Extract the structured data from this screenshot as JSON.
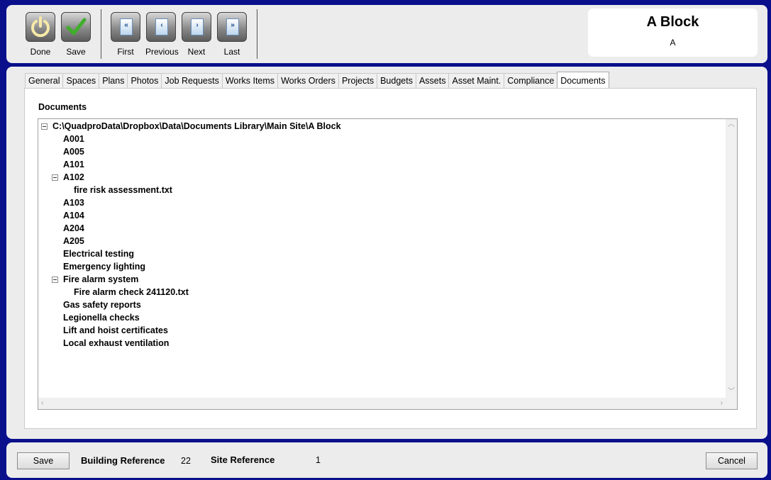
{
  "toolbar": {
    "done_label": "Done",
    "save_label": "Save",
    "first_label": "First",
    "previous_label": "Previous",
    "next_label": "Next",
    "last_label": "Last"
  },
  "header": {
    "title": "A Block",
    "subtitle": "A"
  },
  "tabs": [
    {
      "label": "General"
    },
    {
      "label": "Spaces"
    },
    {
      "label": "Plans"
    },
    {
      "label": "Photos"
    },
    {
      "label": "Job Requests"
    },
    {
      "label": "Works Items"
    },
    {
      "label": "Works Orders"
    },
    {
      "label": "Projects"
    },
    {
      "label": "Budgets"
    },
    {
      "label": "Assets"
    },
    {
      "label": "Asset Maint."
    },
    {
      "label": "Compliance"
    },
    {
      "label": "Documents",
      "active": true
    }
  ],
  "documents": {
    "heading": "Documents",
    "tree": [
      {
        "label": "C:\\QuadproData\\Dropbox\\Data\\Documents Library\\Main Site\\A Block",
        "level": 0,
        "expanded": true
      },
      {
        "label": "A001",
        "level": 1
      },
      {
        "label": "A005",
        "level": 1
      },
      {
        "label": "A101",
        "level": 1
      },
      {
        "label": "A102",
        "level": 1,
        "expanded": true
      },
      {
        "label": "fire risk assessment.txt",
        "level": 2
      },
      {
        "label": "A103",
        "level": 1
      },
      {
        "label": "A104",
        "level": 1
      },
      {
        "label": "A204",
        "level": 1
      },
      {
        "label": "A205",
        "level": 1
      },
      {
        "label": "Electrical testing",
        "level": 1
      },
      {
        "label": "Emergency lighting",
        "level": 1
      },
      {
        "label": "Fire alarm system",
        "level": 1,
        "expanded": true
      },
      {
        "label": "Fire alarm check 241120.txt",
        "level": 2
      },
      {
        "label": "Gas safety reports",
        "level": 1
      },
      {
        "label": "Legionella checks",
        "level": 1
      },
      {
        "label": "Lift and hoist certificates",
        "level": 1
      },
      {
        "label": "Local exhaust ventilation",
        "level": 1
      }
    ]
  },
  "footer": {
    "save_label": "Save",
    "building_reference_label": "Building Reference",
    "building_reference_value": "22",
    "site_reference_label": "Site Reference",
    "site_reference_value": "1",
    "cancel_label": "Cancel"
  },
  "colors": {
    "frame": "#0a0f8c",
    "panel": "#ececec",
    "save_icon_check": "#3fae2a"
  }
}
